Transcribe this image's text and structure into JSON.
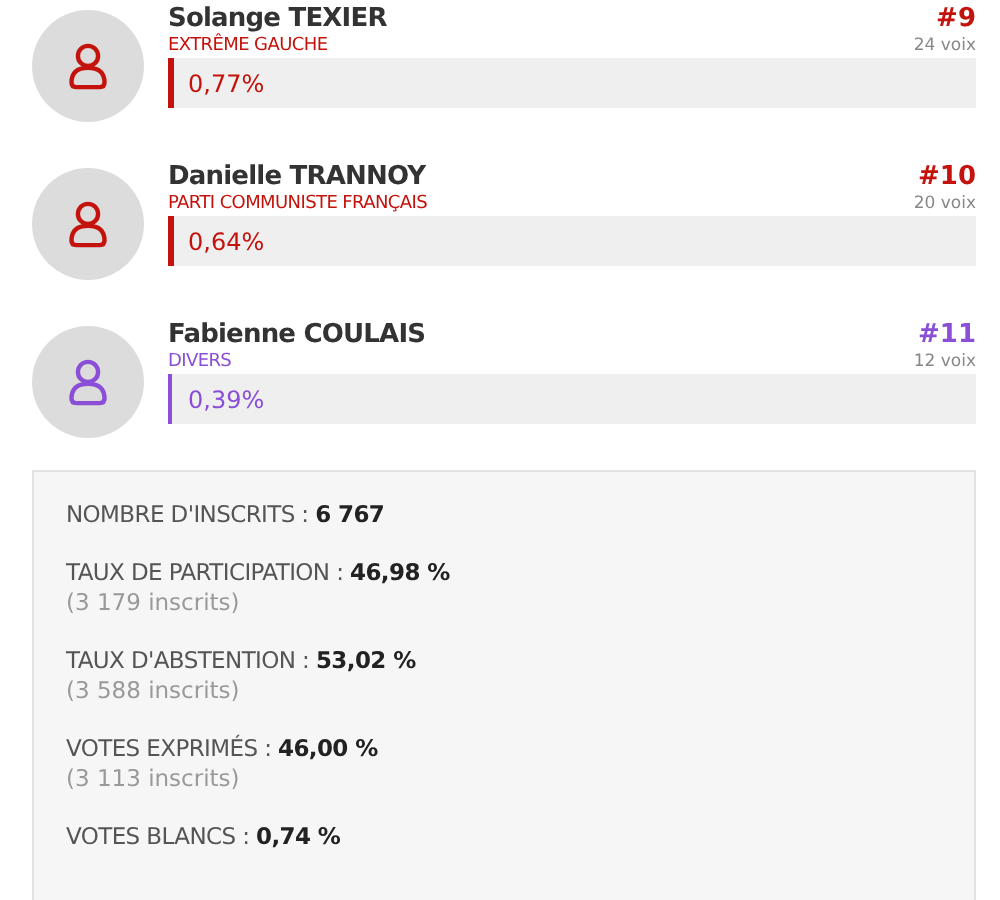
{
  "candidates": [
    {
      "name": "Solange TEXIER",
      "party": "EXTRÊME GAUCHE",
      "color": "#c4120c",
      "percent": "0,77%",
      "level": 0.0077,
      "rank": "#9",
      "votes": "24 voix"
    },
    {
      "name": "Danielle TRANNOY",
      "party": "PARTI COMMUNISTE FRANÇAIS",
      "color": "#c4120c",
      "percent": "0,64%",
      "level": 0.0064,
      "rank": "#10",
      "votes": "20 voix"
    },
    {
      "name": "Fabienne COULAIS",
      "party": "DIVERS",
      "color": "#8a4fd6",
      "percent": "0,39%",
      "level": 0.0039,
      "rank": "#11",
      "votes": "12 voix"
    }
  ],
  "stats": [
    {
      "label": "NOMBRE D'INSCRITS : ",
      "value": "6 767"
    },
    {
      "label": "TAUX DE PARTICIPATION : ",
      "value": "46,98 %",
      "detail": "(3 179 inscrits)"
    },
    {
      "label": "TAUX D'ABSTENTION : ",
      "value": "53,02 %",
      "detail": "(3 588 inscrits)"
    },
    {
      "label": "VOTES EXPRIMÉS : ",
      "value": "46,00 %",
      "detail": "(3 113 inscrits)"
    },
    {
      "label": "VOTES BLANCS : ",
      "value": "0,74 %"
    }
  ]
}
